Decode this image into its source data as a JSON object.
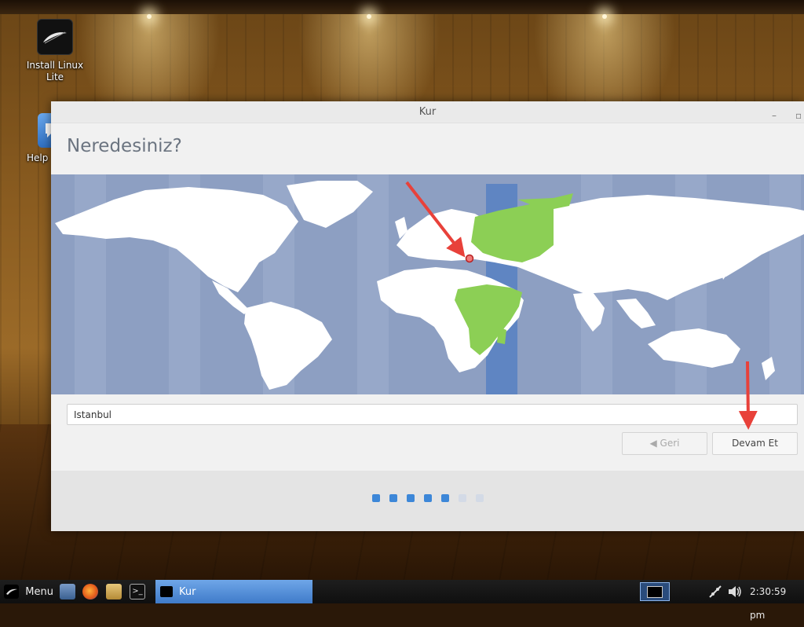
{
  "desktop": {
    "icons": [
      {
        "label": "Install Linux Lite"
      },
      {
        "label": "Help"
      }
    ]
  },
  "window": {
    "title": "Kur",
    "heading": "Neredesiniz?",
    "location_input": {
      "value": "Istanbul"
    },
    "buttons": {
      "back": "Geri",
      "next": "Devam Et"
    },
    "progress": {
      "total_steps": 7,
      "completed_steps": 5
    },
    "map": {
      "selected_city": "Istanbul",
      "timezone_highlight": true
    }
  },
  "taskbar": {
    "menu_label": "Menu",
    "launchers": [
      "file-manager-icon",
      "firefox-icon",
      "home-folder-icon",
      "terminal-icon"
    ],
    "active_task": "Kur",
    "clock": "2:30:59 pm"
  },
  "colors": {
    "map_ocean": "#8d9fc2",
    "map_land": "#ffffff",
    "timezone_band": "#5f85c2",
    "timezone_land": "#8ccf55",
    "progress_done": "#3d87d8",
    "progress_todo": "#d3dae6",
    "annotation_arrow": "#e8413a",
    "taskbar_active": "#4a86d1"
  }
}
